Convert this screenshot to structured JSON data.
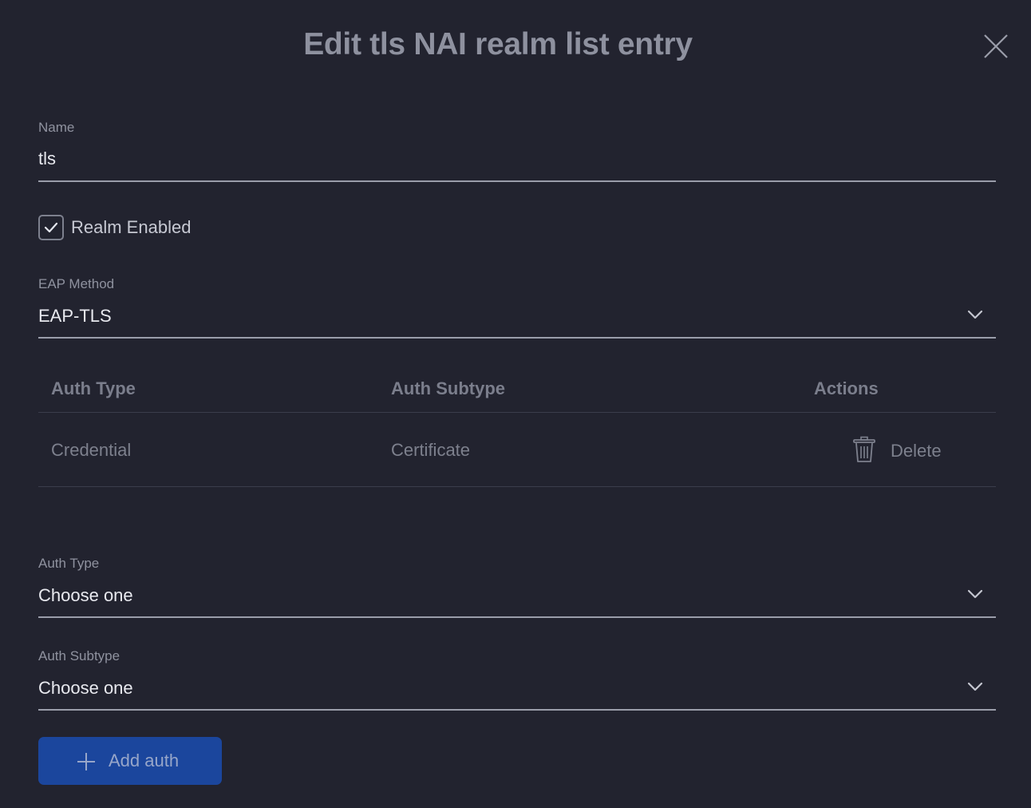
{
  "dialog": {
    "title": "Edit tls NAI realm list entry",
    "close_icon": "close-icon"
  },
  "name_field": {
    "label": "Name",
    "value": "tls"
  },
  "realm_enabled": {
    "label": "Realm Enabled",
    "checked": true
  },
  "eap_method": {
    "label": "EAP Method",
    "value": "EAP-TLS",
    "icon": "chevron-down-icon"
  },
  "auth_table": {
    "columns": [
      "Auth Type",
      "Auth Subtype",
      "Actions"
    ],
    "rows": [
      {
        "auth_type": "Credential",
        "auth_subtype": "Certificate",
        "action_label": "Delete",
        "action_icon": "trash-icon"
      }
    ]
  },
  "auth_type_select": {
    "label": "Auth Type",
    "value": "Choose one",
    "icon": "chevron-down-icon"
  },
  "auth_subtype_select": {
    "label": "Auth Subtype",
    "value": "Choose one",
    "icon": "chevron-down-icon"
  },
  "add_auth_button": {
    "label": "Add auth",
    "icon": "plus-icon",
    "color": "#1b469d"
  },
  "colors": {
    "background": "#22232f",
    "accent": "#1b469d"
  }
}
